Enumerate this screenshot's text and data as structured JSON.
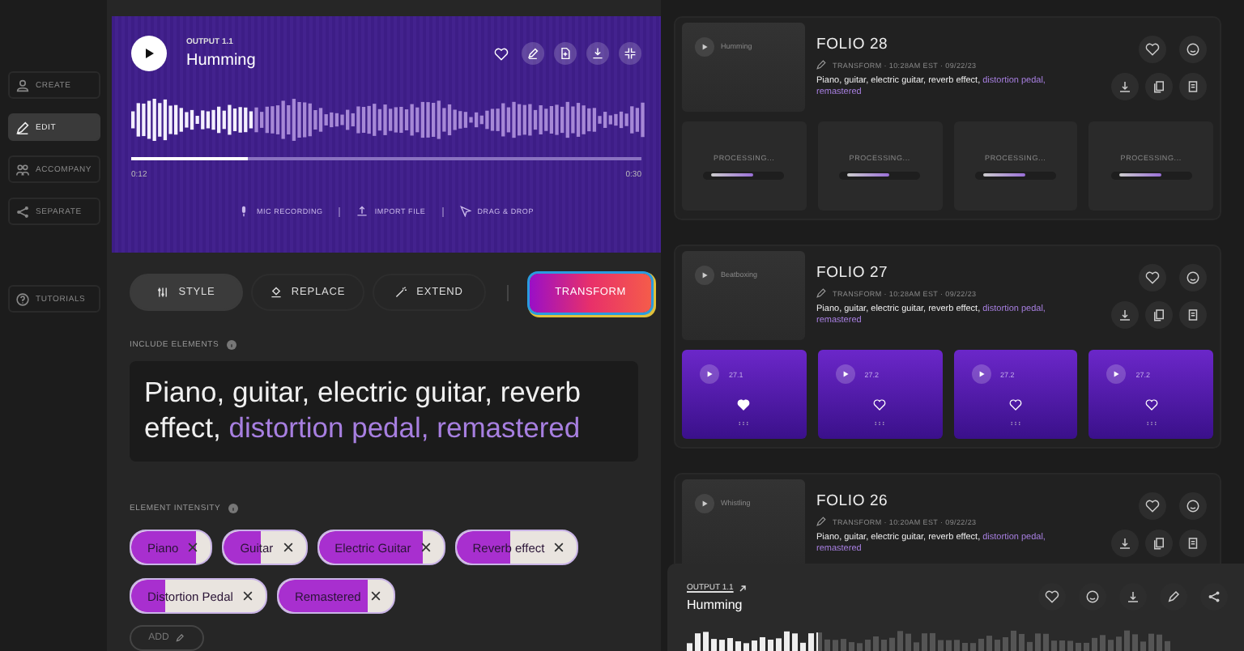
{
  "sidebar": {
    "items": [
      {
        "label": "CREATE",
        "selected": false
      },
      {
        "label": "EDIT",
        "selected": true
      },
      {
        "label": "ACCOMPANY",
        "selected": false
      },
      {
        "label": "SEPARATE",
        "selected": false
      }
    ],
    "footer_item": {
      "label": "TUTORIALS"
    }
  },
  "player": {
    "eyebrow": "OUTPUT 1.1",
    "title": "Humming",
    "liked": false,
    "progress": {
      "level": 0.23
    },
    "time_start": "0:12",
    "time_end": "0:30",
    "sources": [
      {
        "label": "MIC RECORDING"
      },
      {
        "label": "IMPORT FILE"
      },
      {
        "label": "DRAG & DROP"
      }
    ]
  },
  "modes": [
    {
      "label": "STYLE",
      "selected": true
    },
    {
      "label": "REPLACE",
      "selected": false
    },
    {
      "label": "EXTEND",
      "selected": false
    }
  ],
  "action_button": {
    "label": "TRANSFORM"
  },
  "include_elements": {
    "label": "INCLUDE ELEMENTS",
    "text": "Piano, guitar, electric guitar, reverb effect,",
    "highlighted_text": "distortion pedal, remastered"
  },
  "intensity": {
    "label": "ELEMENT INTENSITY",
    "add_label": "ADD",
    "chips": [
      {
        "label": "Piano",
        "level": 0.82
      },
      {
        "label": "Guitar",
        "level": 0.45
      },
      {
        "label": "Electric Guitar",
        "level": 0.84
      },
      {
        "label": "Reverb effect",
        "level": 0.45
      },
      {
        "label": "Distortion Pedal",
        "level": 0.25
      },
      {
        "label": "Remastered",
        "level": 0.78
      }
    ]
  },
  "folios": [
    {
      "title": "FOLIO 28",
      "preview": "Humming",
      "meta": "TRANSFORM · 10:28AM EST · 09/22/23",
      "text": "Piano, guitar, electric guitar, reverb effect,",
      "highlighted_text": "distortion pedal, remastered",
      "outputs": [
        {
          "kind": "processing",
          "label": "PROCESSING...",
          "level": 0.65
        },
        {
          "kind": "processing",
          "label": "PROCESSING...",
          "level": 0.65
        },
        {
          "kind": "processing",
          "label": "PROCESSING...",
          "level": 0.65
        },
        {
          "kind": "processing",
          "label": "PROCESSING...",
          "level": 0.65
        }
      ]
    },
    {
      "title": "FOLIO 27",
      "preview": "Beatboxing",
      "meta": "TRANSFORM · 10:28AM EST · 09/22/23",
      "text": "Piano, guitar, electric guitar, reverb effect,",
      "highlighted_text": "distortion pedal, remastered",
      "outputs": [
        {
          "kind": "variant",
          "label": "27.1",
          "liked": true
        },
        {
          "kind": "variant",
          "label": "27.2",
          "liked": false
        },
        {
          "kind": "variant",
          "label": "27.2",
          "liked": false
        },
        {
          "kind": "variant",
          "label": "27.2",
          "liked": false
        }
      ]
    },
    {
      "title": "FOLIO 26",
      "preview": "Whistling",
      "meta": "TRANSFORM · 10:20AM EST · 09/22/23",
      "text": "Piano, guitar, electric guitar, reverb effect,",
      "highlighted_text": "distortion pedal, remastered"
    }
  ],
  "mini_player": {
    "eyebrow": "OUTPUT 1.1",
    "title": "Humming",
    "progress": {
      "level": 0.27
    }
  }
}
